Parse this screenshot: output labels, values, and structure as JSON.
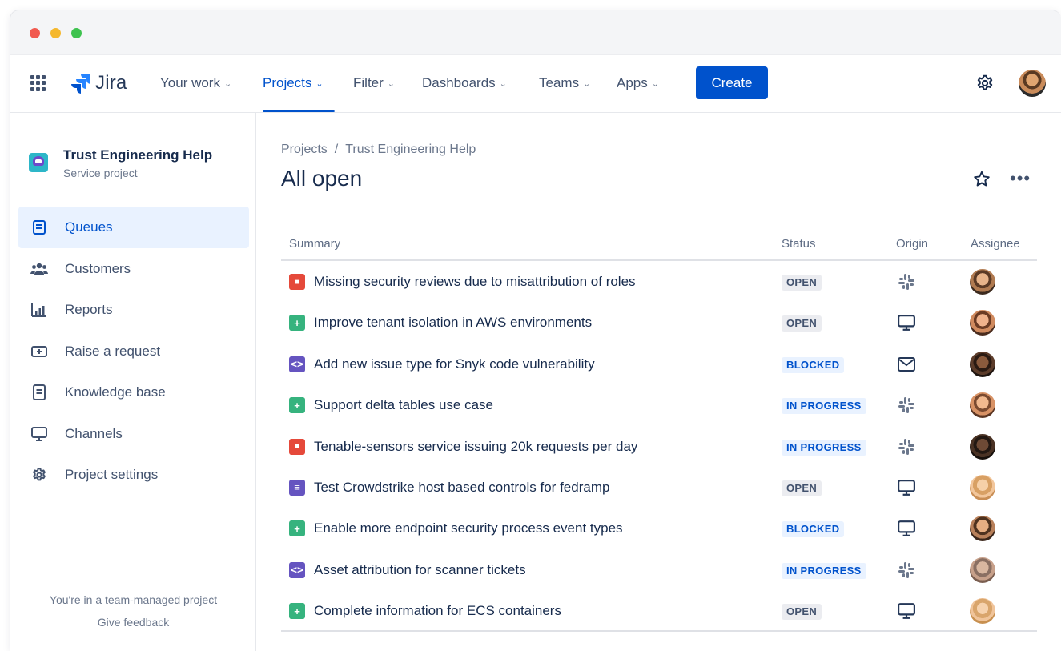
{
  "nav": {
    "logo_text": "Jira",
    "items": [
      {
        "label": "Your work",
        "active": false
      },
      {
        "label": "Projects",
        "active": true
      },
      {
        "label": "Filter",
        "active": false
      },
      {
        "label": "Dashboards",
        "active": false
      },
      {
        "label": "Teams",
        "active": false
      },
      {
        "label": "Apps",
        "active": false
      }
    ],
    "create_label": "Create"
  },
  "sidebar": {
    "project_name": "Trust Engineering Help",
    "project_type": "Service project",
    "items": [
      {
        "label": "Queues",
        "icon": "queues-icon",
        "active": true
      },
      {
        "label": "Customers",
        "icon": "customers-icon",
        "active": false
      },
      {
        "label": "Reports",
        "icon": "reports-icon",
        "active": false
      },
      {
        "label": "Raise a request",
        "icon": "raise-request-icon",
        "active": false
      },
      {
        "label": "Knowledge base",
        "icon": "knowledge-base-icon",
        "active": false
      },
      {
        "label": "Channels",
        "icon": "channels-icon",
        "active": false
      },
      {
        "label": "Project settings",
        "icon": "gear-icon",
        "active": false
      }
    ],
    "footer_note": "You're in a team-managed project",
    "feedback_label": "Give feedback"
  },
  "main": {
    "breadcrumb": [
      "Projects",
      "Trust Engineering Help"
    ],
    "title": "All open",
    "columns": {
      "summary": "Summary",
      "status": "Status",
      "origin": "Origin",
      "assignee": "Assignee"
    },
    "rows": [
      {
        "type": "bug",
        "summary": "Missing security reviews due to misattribution of roles",
        "status": "OPEN",
        "origin": "slack"
      },
      {
        "type": "new-feature",
        "summary": "Improve tenant isolation in AWS environments",
        "status": "OPEN",
        "origin": "portal"
      },
      {
        "type": "code",
        "summary": "Add new issue type for Snyk code vulnerability",
        "status": "BLOCKED",
        "origin": "email"
      },
      {
        "type": "new-feature",
        "summary": "Support delta tables use case",
        "status": "IN PROGRESS",
        "origin": "slack"
      },
      {
        "type": "bug",
        "summary": "Tenable-sensors service issuing 20k requests per day",
        "status": "IN PROGRESS",
        "origin": "slack"
      },
      {
        "type": "task",
        "summary": "Test Crowdstrike host based controls for fedramp",
        "status": "OPEN",
        "origin": "portal"
      },
      {
        "type": "new-feature",
        "summary": "Enable more endpoint security process event types",
        "status": "BLOCKED",
        "origin": "portal"
      },
      {
        "type": "code",
        "summary": "Asset attribution for scanner tickets",
        "status": "IN PROGRESS",
        "origin": "slack"
      },
      {
        "type": "new-feature",
        "summary": "Complete information for ECS containers",
        "status": "OPEN",
        "origin": "portal"
      }
    ]
  },
  "colors": {
    "brand_blue": "#0052CC",
    "bug_red": "#E5493A",
    "feature_green": "#36B37E",
    "code_purple": "#6554C0"
  }
}
